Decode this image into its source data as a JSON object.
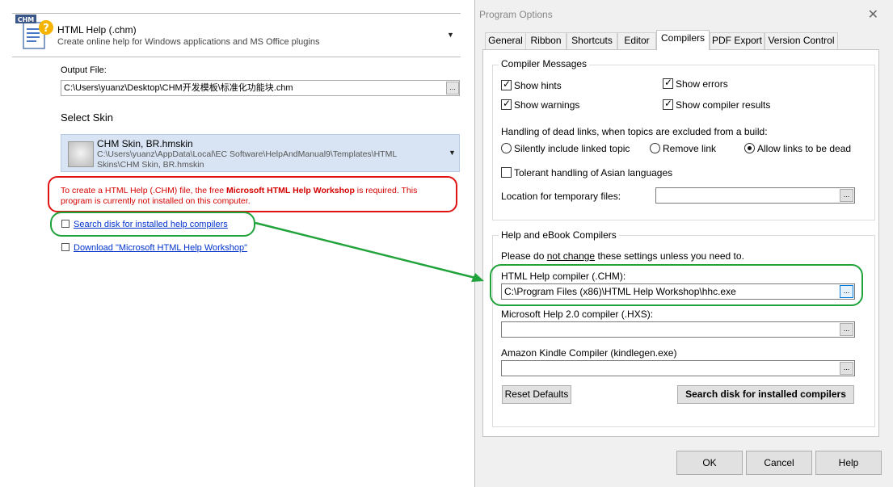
{
  "left": {
    "format": {
      "badge": "CHM",
      "title": "HTML Help (.chm)",
      "subtitle": "Create online help for Windows applications and MS Office plugins"
    },
    "output_file": {
      "label": "Output File:",
      "value": "C:\\Users\\yuanz\\Desktop\\CHM开发模板\\标准化功能块.chm",
      "browse": "..."
    },
    "skin": {
      "heading": "Select Skin",
      "name": "CHM Skin, BR.hmskin",
      "path": "C:\\Users\\yuanz\\AppData\\Local\\EC Software\\HelpAndManual9\\Templates\\HTML Skins\\CHM Skin, BR.hmskin"
    },
    "warning": {
      "pre": "To create a HTML Help (.CHM) file, the free ",
      "bold": "Microsoft HTML Help Workshop",
      "post": " is required. This program is currently not installed on this computer."
    },
    "links": {
      "search": "Search disk for installed help compilers",
      "download": "Download \"Microsoft HTML Help Workshop\""
    }
  },
  "dialog": {
    "title": "Program Options",
    "close": "✕",
    "tabs": [
      "General",
      "Ribbon",
      "Shortcuts",
      "Editor",
      "Compilers",
      "PDF Export",
      "Version Control"
    ],
    "active_tab": "Compilers",
    "compiler_messages": {
      "title": "Compiler Messages",
      "show_hints": "Show hints",
      "show_errors": "Show errors",
      "show_warnings": "Show warnings",
      "show_compiler_results": "Show compiler results",
      "dead_links_label": "Handling of dead links, when topics are excluded from a build:",
      "radio_silently": "Silently include linked topic",
      "radio_remove": "Remove link",
      "radio_allow": "Allow links to be dead",
      "asian": "Tolerant handling of Asian languages",
      "temp_label": "Location for temporary files:",
      "temp_value": ""
    },
    "compilers": {
      "title": "Help and eBook Compilers",
      "note_pre": "Please do ",
      "note_underline": "not change",
      "note_post": " these settings unless you need to.",
      "chm_label": "HTML Help compiler (.CHM):",
      "chm_value": "C:\\Program Files (x86)\\HTML Help Workshop\\hhc.exe",
      "hxs_label": "Microsoft Help 2.0 compiler (.HXS):",
      "hxs_value": "",
      "kindle_label": "Amazon Kindle Compiler (kindlegen.exe)",
      "kindle_value": "",
      "reset": "Reset Defaults",
      "search": "Search disk for installed compilers",
      "browse": "..."
    },
    "buttons": {
      "ok": "OK",
      "cancel": "Cancel",
      "help": "Help"
    }
  },
  "colors": {
    "annotation_red": "#e01414",
    "annotation_green": "#1fa33a",
    "link": "#0033cc",
    "warning_text": "#d40000",
    "skin_highlight": "#d8e4f3"
  }
}
